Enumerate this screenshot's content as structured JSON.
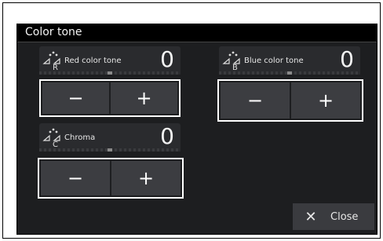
{
  "window": {
    "title": "Color tone"
  },
  "controls": [
    {
      "label": "Red color tone",
      "letter": "R",
      "value": "0",
      "minus": "−",
      "plus": "+"
    },
    {
      "label": "Blue color tone",
      "letter": "B",
      "value": "0",
      "minus": "−",
      "plus": "+"
    },
    {
      "label": "Chroma",
      "letter": "C",
      "value": "0",
      "minus": "−",
      "plus": "+"
    }
  ],
  "close": {
    "icon": "close-icon",
    "glyph": "✕",
    "label": "Close"
  }
}
